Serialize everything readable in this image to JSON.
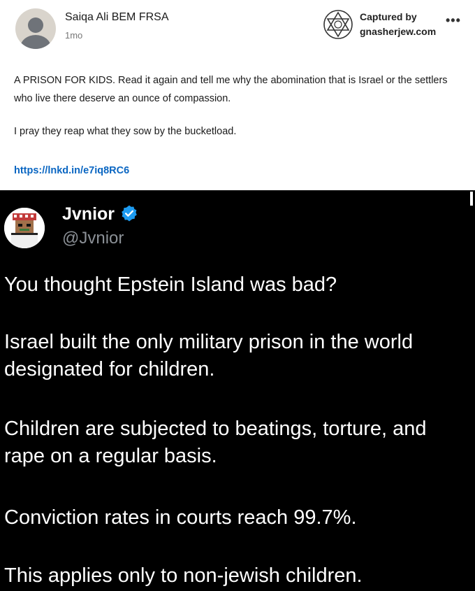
{
  "post": {
    "author": "Saiqa Ali BEM FRSA",
    "time": "1mo",
    "paragraph1": "A PRISON FOR KIDS. Read it again and tell me why the abomination that is Israel or the settlers who live there deserve an ounce of compassion.",
    "paragraph2": "I pray they reap what they sow by the bucketload.",
    "link": "https://lnkd.in/e7iq8RC6",
    "more_icon": "more-horizontal-icon"
  },
  "watermark": {
    "line1": "Captured by",
    "line2": "gnasherjew.com",
    "icon": "star-of-david-icon"
  },
  "tweet": {
    "name": "Jvnior",
    "handle": "@Jvnior",
    "verified": true,
    "badge_color": "#1d9bf0",
    "lines": [
      "You thought Epstein Island was bad?",
      "Israel built the only military prison in the world designated for children.",
      "Children are subjected to beatings, torture, and rape on a regular basis.",
      "Conviction rates in courts reach 99.7%.",
      "This applies only to non-jewish children."
    ]
  },
  "colors": {
    "link": "#0a66c2",
    "tweet_bg": "#000000",
    "handle": "#8b9096"
  }
}
